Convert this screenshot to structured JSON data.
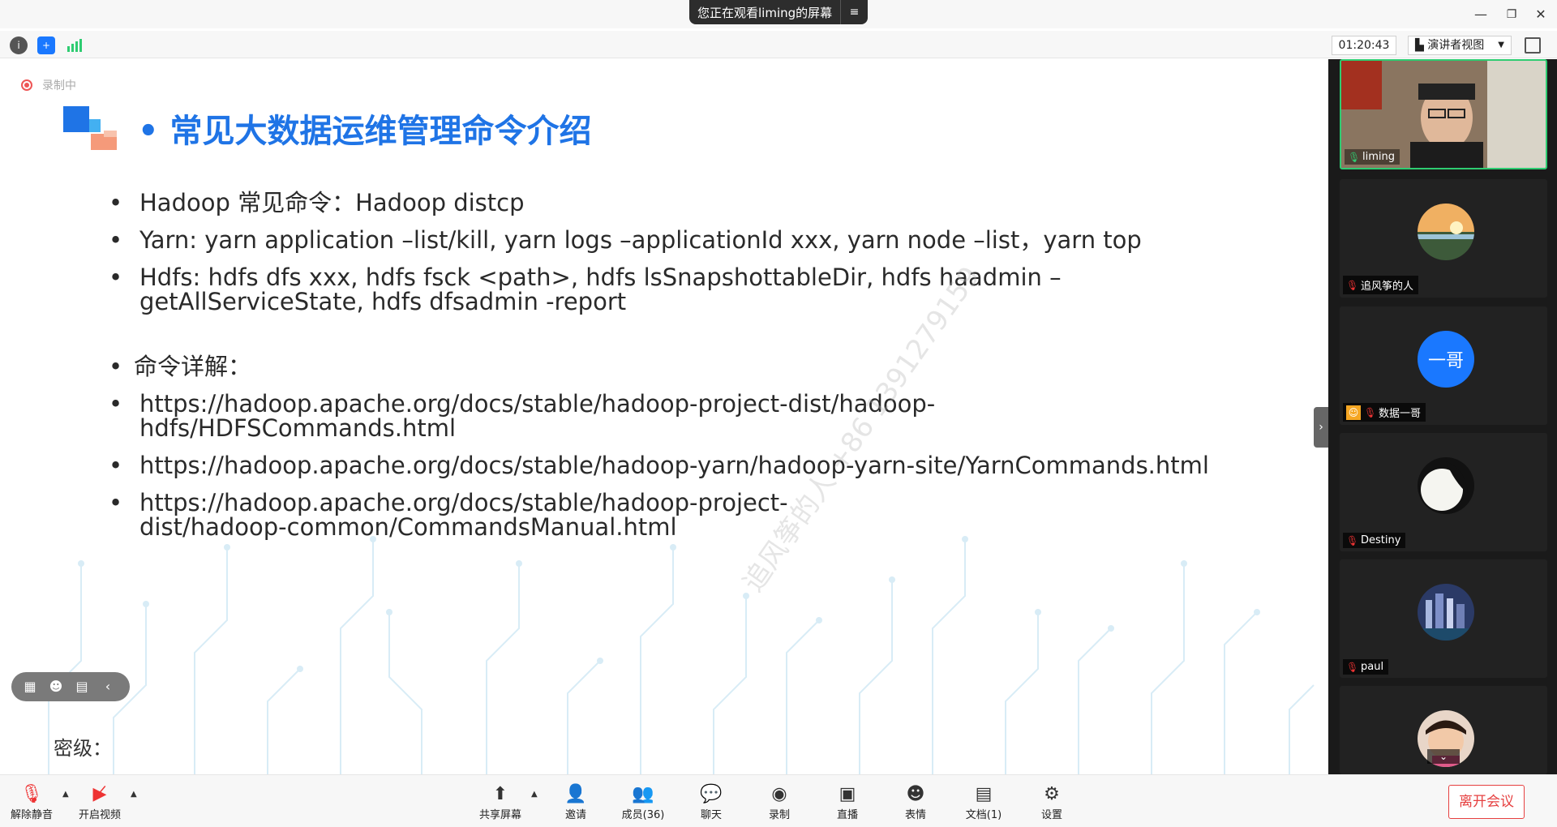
{
  "window": {
    "share_banner": "您正在观看liming的屏幕",
    "menu_icon": "≡",
    "minimize": "—",
    "restore": "❐",
    "close": "✕"
  },
  "toolbar": {
    "timer": "01:20:43",
    "view_label": "演讲者视图"
  },
  "recording": {
    "label": "录制中"
  },
  "slide": {
    "title": "• 常见大数据运维管理命令介绍",
    "bullets": [
      "Hadoop 常见命令：Hadoop distcp",
      "Yarn:  yarn application –list/kill, yarn logs –applicationId xxx, yarn node –list，yarn top",
      "Hdfs: hdfs dfs xxx, hdfs fsck <path>, hdfs lsSnapshottableDir, hdfs haadmin –getAllServiceState, hdfs dfsadmin -report",
      "命令详解：",
      "https://hadoop.apache.org/docs/stable/hadoop-project-dist/hadoop-hdfs/HDFSCommands.html",
      "https://hadoop.apache.org/docs/stable/hadoop-yarn/hadoop-yarn-site/YarnCommands.html",
      "https://hadoop.apache.org/docs/stable/hadoop-project-dist/hadoop-common/CommandsManual.html"
    ],
    "watermark": "追风筝的人 +86 1391279159",
    "secret_label": "密级："
  },
  "participants": [
    {
      "name": "liming",
      "mic": "on"
    },
    {
      "name": "追风筝的人",
      "mic": "muted"
    },
    {
      "name": "数据一哥",
      "avatar_text": "一哥",
      "mic": "muted"
    },
    {
      "name": "Destiny",
      "mic": "muted"
    },
    {
      "name": "paul",
      "mic": "muted"
    },
    {
      "name": "",
      "mic": "muted"
    }
  ],
  "bottombar": {
    "unmute": "解除静音",
    "video": "开启视频",
    "share": "共享屏幕",
    "invite": "邀请",
    "members": "成员(36)",
    "chat": "聊天",
    "record": "录制",
    "live": "直播",
    "reactions": "表情",
    "docs": "文档(1)",
    "settings": "设置",
    "leave": "离开会议"
  },
  "colors": {
    "accent": "#1f74e6",
    "leave": "#e64040",
    "active_speaker": "#2ecc71"
  }
}
